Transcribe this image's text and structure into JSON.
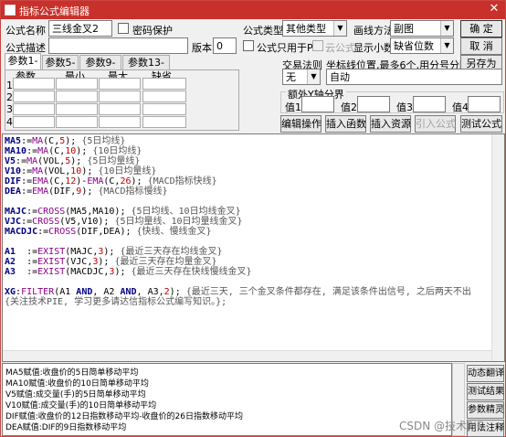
{
  "window": {
    "title": "指标公式编辑器",
    "close": "✕"
  },
  "top": {
    "name_label": "公式名称",
    "name_value": "三线金叉2",
    "pwd_label": "密码保护",
    "desc_label": "公式描述",
    "version_label": "版本",
    "version_value": "0",
    "type_label": "公式类型",
    "type_value": "其他类型",
    "draw_label": "画线方法",
    "draw_value": "副图",
    "pconly_label": "公式只用于PC",
    "cloud_label": "云公式",
    "decimals_label": "显示小数",
    "decimals_value": "缺省位数",
    "ok": "确 定",
    "cancel": "取 消",
    "saveas": "另存为"
  },
  "tabs": [
    "参数1-4",
    "参数5-8",
    "参数9-12",
    "参数13-16"
  ],
  "params": {
    "headers": [
      "参数",
      "最小",
      "最大",
      "缺省"
    ],
    "rows": [
      "1",
      "2",
      "3",
      "4"
    ]
  },
  "right": {
    "trade_label": "交易法则",
    "coord_label": "坐标线位置,最多6个,用分号分隔",
    "trade_value": "无",
    "coord_value": "自动",
    "ylines_label": "额外Y轴分界",
    "vals": [
      "值1",
      "值2",
      "值3",
      "值4"
    ],
    "btn_edit": "编辑操作",
    "btn_func": "插入函数",
    "btn_res": "插入资源",
    "btn_import": "引入公式",
    "btn_test": "测试公式"
  },
  "code": [
    [
      [
        "k",
        "MA5"
      ],
      [
        "",
        ":="
      ],
      [
        "f",
        "MA"
      ],
      [
        "",
        "(C,"
      ],
      [
        "n",
        "5"
      ],
      [
        "",
        "); "
      ],
      [
        "c",
        "{5日均线}"
      ]
    ],
    [
      [
        "k",
        "MA10"
      ],
      [
        "",
        ":="
      ],
      [
        "f",
        "MA"
      ],
      [
        "",
        "(C,"
      ],
      [
        "n",
        "10"
      ],
      [
        "",
        "); "
      ],
      [
        "c",
        "{10日均线}"
      ]
    ],
    [
      [
        "k",
        "V5"
      ],
      [
        "",
        ":="
      ],
      [
        "f",
        "MA"
      ],
      [
        "",
        "(VOL,"
      ],
      [
        "n",
        "5"
      ],
      [
        "",
        "); "
      ],
      [
        "c",
        "{5日均量线}"
      ]
    ],
    [
      [
        "k",
        "V10"
      ],
      [
        "",
        ":="
      ],
      [
        "f",
        "MA"
      ],
      [
        "",
        "(VOL,"
      ],
      [
        "n",
        "10"
      ],
      [
        "",
        "); "
      ],
      [
        "c",
        "{10日均量线}"
      ]
    ],
    [
      [
        "k",
        "DIF"
      ],
      [
        "",
        ":="
      ],
      [
        "f",
        "EMA"
      ],
      [
        "",
        "(C,"
      ],
      [
        "n",
        "12"
      ],
      [
        "",
        ")-"
      ],
      [
        "f",
        "EMA"
      ],
      [
        "",
        "(C,"
      ],
      [
        "n",
        "26"
      ],
      [
        "",
        "); "
      ],
      [
        "c",
        "{MACD指标快线}"
      ]
    ],
    [
      [
        "k",
        "DEA"
      ],
      [
        "",
        ":="
      ],
      [
        "f",
        "EMA"
      ],
      [
        "",
        "(DIF,"
      ],
      [
        "n",
        "9"
      ],
      [
        "",
        "); "
      ],
      [
        "c",
        "{MACD指标慢线}"
      ]
    ],
    [],
    [
      [
        "k",
        "MAJC"
      ],
      [
        "",
        ":="
      ],
      [
        "f",
        "CROSS"
      ],
      [
        "",
        "(MA5,MA10); "
      ],
      [
        "c",
        "{5日均线、10日均线金叉}"
      ]
    ],
    [
      [
        "k",
        "VJC"
      ],
      [
        "",
        ":="
      ],
      [
        "f",
        "CROSS"
      ],
      [
        "",
        "(V5,V10); "
      ],
      [
        "c",
        "{5日均量线、10日均量线金叉}"
      ]
    ],
    [
      [
        "k",
        "MACDJC"
      ],
      [
        "",
        ":="
      ],
      [
        "f",
        "CROSS"
      ],
      [
        "",
        "(DIF,DEA); "
      ],
      [
        "c",
        "{快线、慢线金叉}"
      ]
    ],
    [],
    [
      [
        "k",
        "A1"
      ],
      [
        "",
        "  :="
      ],
      [
        "f",
        "EXIST"
      ],
      [
        "",
        "(MAJC,"
      ],
      [
        "n",
        "3"
      ],
      [
        "",
        "); "
      ],
      [
        "c",
        "{最近三天存在均线金叉}"
      ]
    ],
    [
      [
        "k",
        "A2"
      ],
      [
        "",
        "  :="
      ],
      [
        "f",
        "EXIST"
      ],
      [
        "",
        "(VJC,"
      ],
      [
        "n",
        "3"
      ],
      [
        "",
        "); "
      ],
      [
        "c",
        "{最近三天存在均量金叉}"
      ]
    ],
    [
      [
        "k",
        "A3"
      ],
      [
        "",
        "  :="
      ],
      [
        "f",
        "EXIST"
      ],
      [
        "",
        "(MACDJC,"
      ],
      [
        "n",
        "3"
      ],
      [
        "",
        "); "
      ],
      [
        "c",
        "{最近三天存在快线慢线金叉}"
      ]
    ],
    [],
    [
      [
        "k",
        "XG"
      ],
      [
        "",
        ":"
      ],
      [
        "f",
        "FILTER"
      ],
      [
        "",
        "(A1 "
      ],
      [
        "k",
        "AND"
      ],
      [
        "",
        ", A2 "
      ],
      [
        "k",
        "AND"
      ],
      [
        "",
        ", A3,"
      ],
      [
        "n",
        "2"
      ],
      [
        "",
        "); "
      ],
      [
        "c",
        "{最近三天, 三个金叉条件都存在, 满足该条件出信号, 之后两天不出"
      ]
    ],
    [
      [
        "c",
        "{关注技术PIE, 学习更多请达信指标公式编写知识。};"
      ]
    ]
  ],
  "desc_lines": [
    "MA5赋值:收盘价的5日简单移动平均",
    "MA10赋值:收盘价的10日简单移动平均",
    "V5赋值:成交量(手)的5日简单移动平均",
    "V10赋值:成交量(手)的10日简单移动平均",
    "DIF赋值:收盘价的12日指数移动平均-收盘价的26日指数移动平均",
    "DEA赋值:DIF的9日指数移动平均"
  ],
  "side_btns": [
    "动态翻译",
    "测试结果",
    "参数精灵",
    "用法注释"
  ],
  "watermark": "CSDN @技术PIE"
}
